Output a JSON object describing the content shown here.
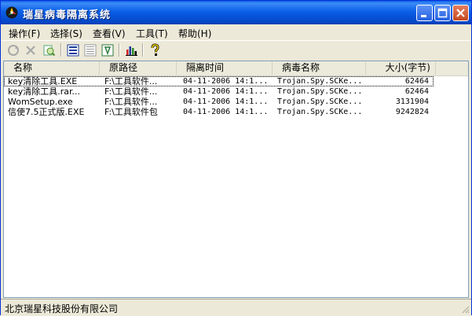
{
  "window": {
    "title": "瑞星病毒隔离系统"
  },
  "menu": [
    {
      "label": "操作(F)"
    },
    {
      "label": "选择(S)"
    },
    {
      "label": "查看(V)"
    },
    {
      "label": "工具(T)"
    },
    {
      "label": "帮助(H)"
    }
  ],
  "toolbar": {
    "icons": [
      "restore-icon",
      "delete-icon",
      "scan-icon",
      "large-icons-icon",
      "list-view-icon",
      "details-view-icon",
      "statistics-icon",
      "help-icon"
    ]
  },
  "list": {
    "columns": [
      "名称",
      "原路径",
      "隔离时间",
      "病毒名称",
      "大小(字节)"
    ],
    "rows": [
      {
        "name": "key清除工具.EXE",
        "path": "F:\\工具软件...",
        "time": "04-11-2006 14:1...",
        "virus": "Trojan.Spy.SCKe...",
        "size": "62464"
      },
      {
        "name": "key清除工具.rar...",
        "path": "F:\\工具软件...",
        "time": "04-11-2006 14:1...",
        "virus": "Trojan.Spy.SCKe...",
        "size": "62464"
      },
      {
        "name": "WomSetup.exe",
        "path": "F:\\工具软件...",
        "time": "04-11-2006 14:1...",
        "virus": "Trojan.Spy.SCKe...",
        "size": "3131904"
      },
      {
        "name": "信使7.5正式版.EXE",
        "path": "F:\\工具软件包",
        "time": "04-11-2006 14:1...",
        "virus": "Trojan.Spy.SCKe...",
        "size": "9242824"
      }
    ]
  },
  "status": {
    "text": "北京瑞星科技股份有限公司"
  },
  "colors": {
    "title_bar": "#0a5fe8",
    "close_button": "#c44a1f",
    "window_bg": "#ece9d8"
  }
}
